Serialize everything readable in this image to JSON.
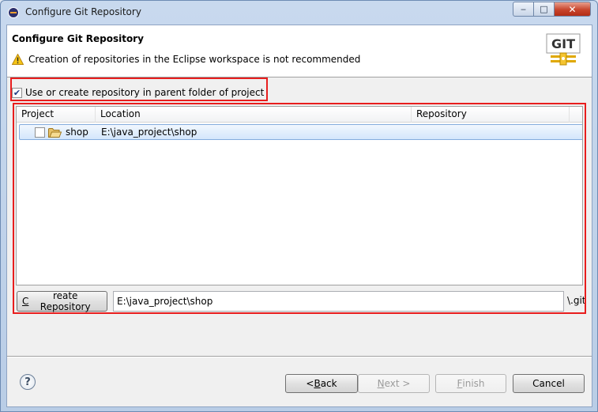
{
  "window": {
    "title": "Configure Git Repository",
    "minimize": "‒",
    "maximize": "□",
    "close": "✕"
  },
  "header": {
    "title": "Configure Git Repository",
    "message": "Creation of repositories in the Eclipse workspace is not recommended",
    "logo_text": "GIT"
  },
  "option": {
    "label": "Use or create repository in parent folder of project",
    "checked": true
  },
  "table": {
    "columns": [
      "Project",
      "Location",
      "Repository"
    ],
    "rows": [
      {
        "project": "shop",
        "location": "E:\\java_project\\shop",
        "repository": "",
        "checked": false
      }
    ]
  },
  "create": {
    "button_label": "Create Repository",
    "path_value": "E:\\java_project\\shop",
    "suffix": "\\.git"
  },
  "footer": {
    "help": "?",
    "back": "< Back",
    "next": "Next >",
    "finish": "Finish",
    "cancel": "Cancel"
  },
  "colors": {
    "highlight": "#e81e1e",
    "selection": "#d4e6fb"
  }
}
